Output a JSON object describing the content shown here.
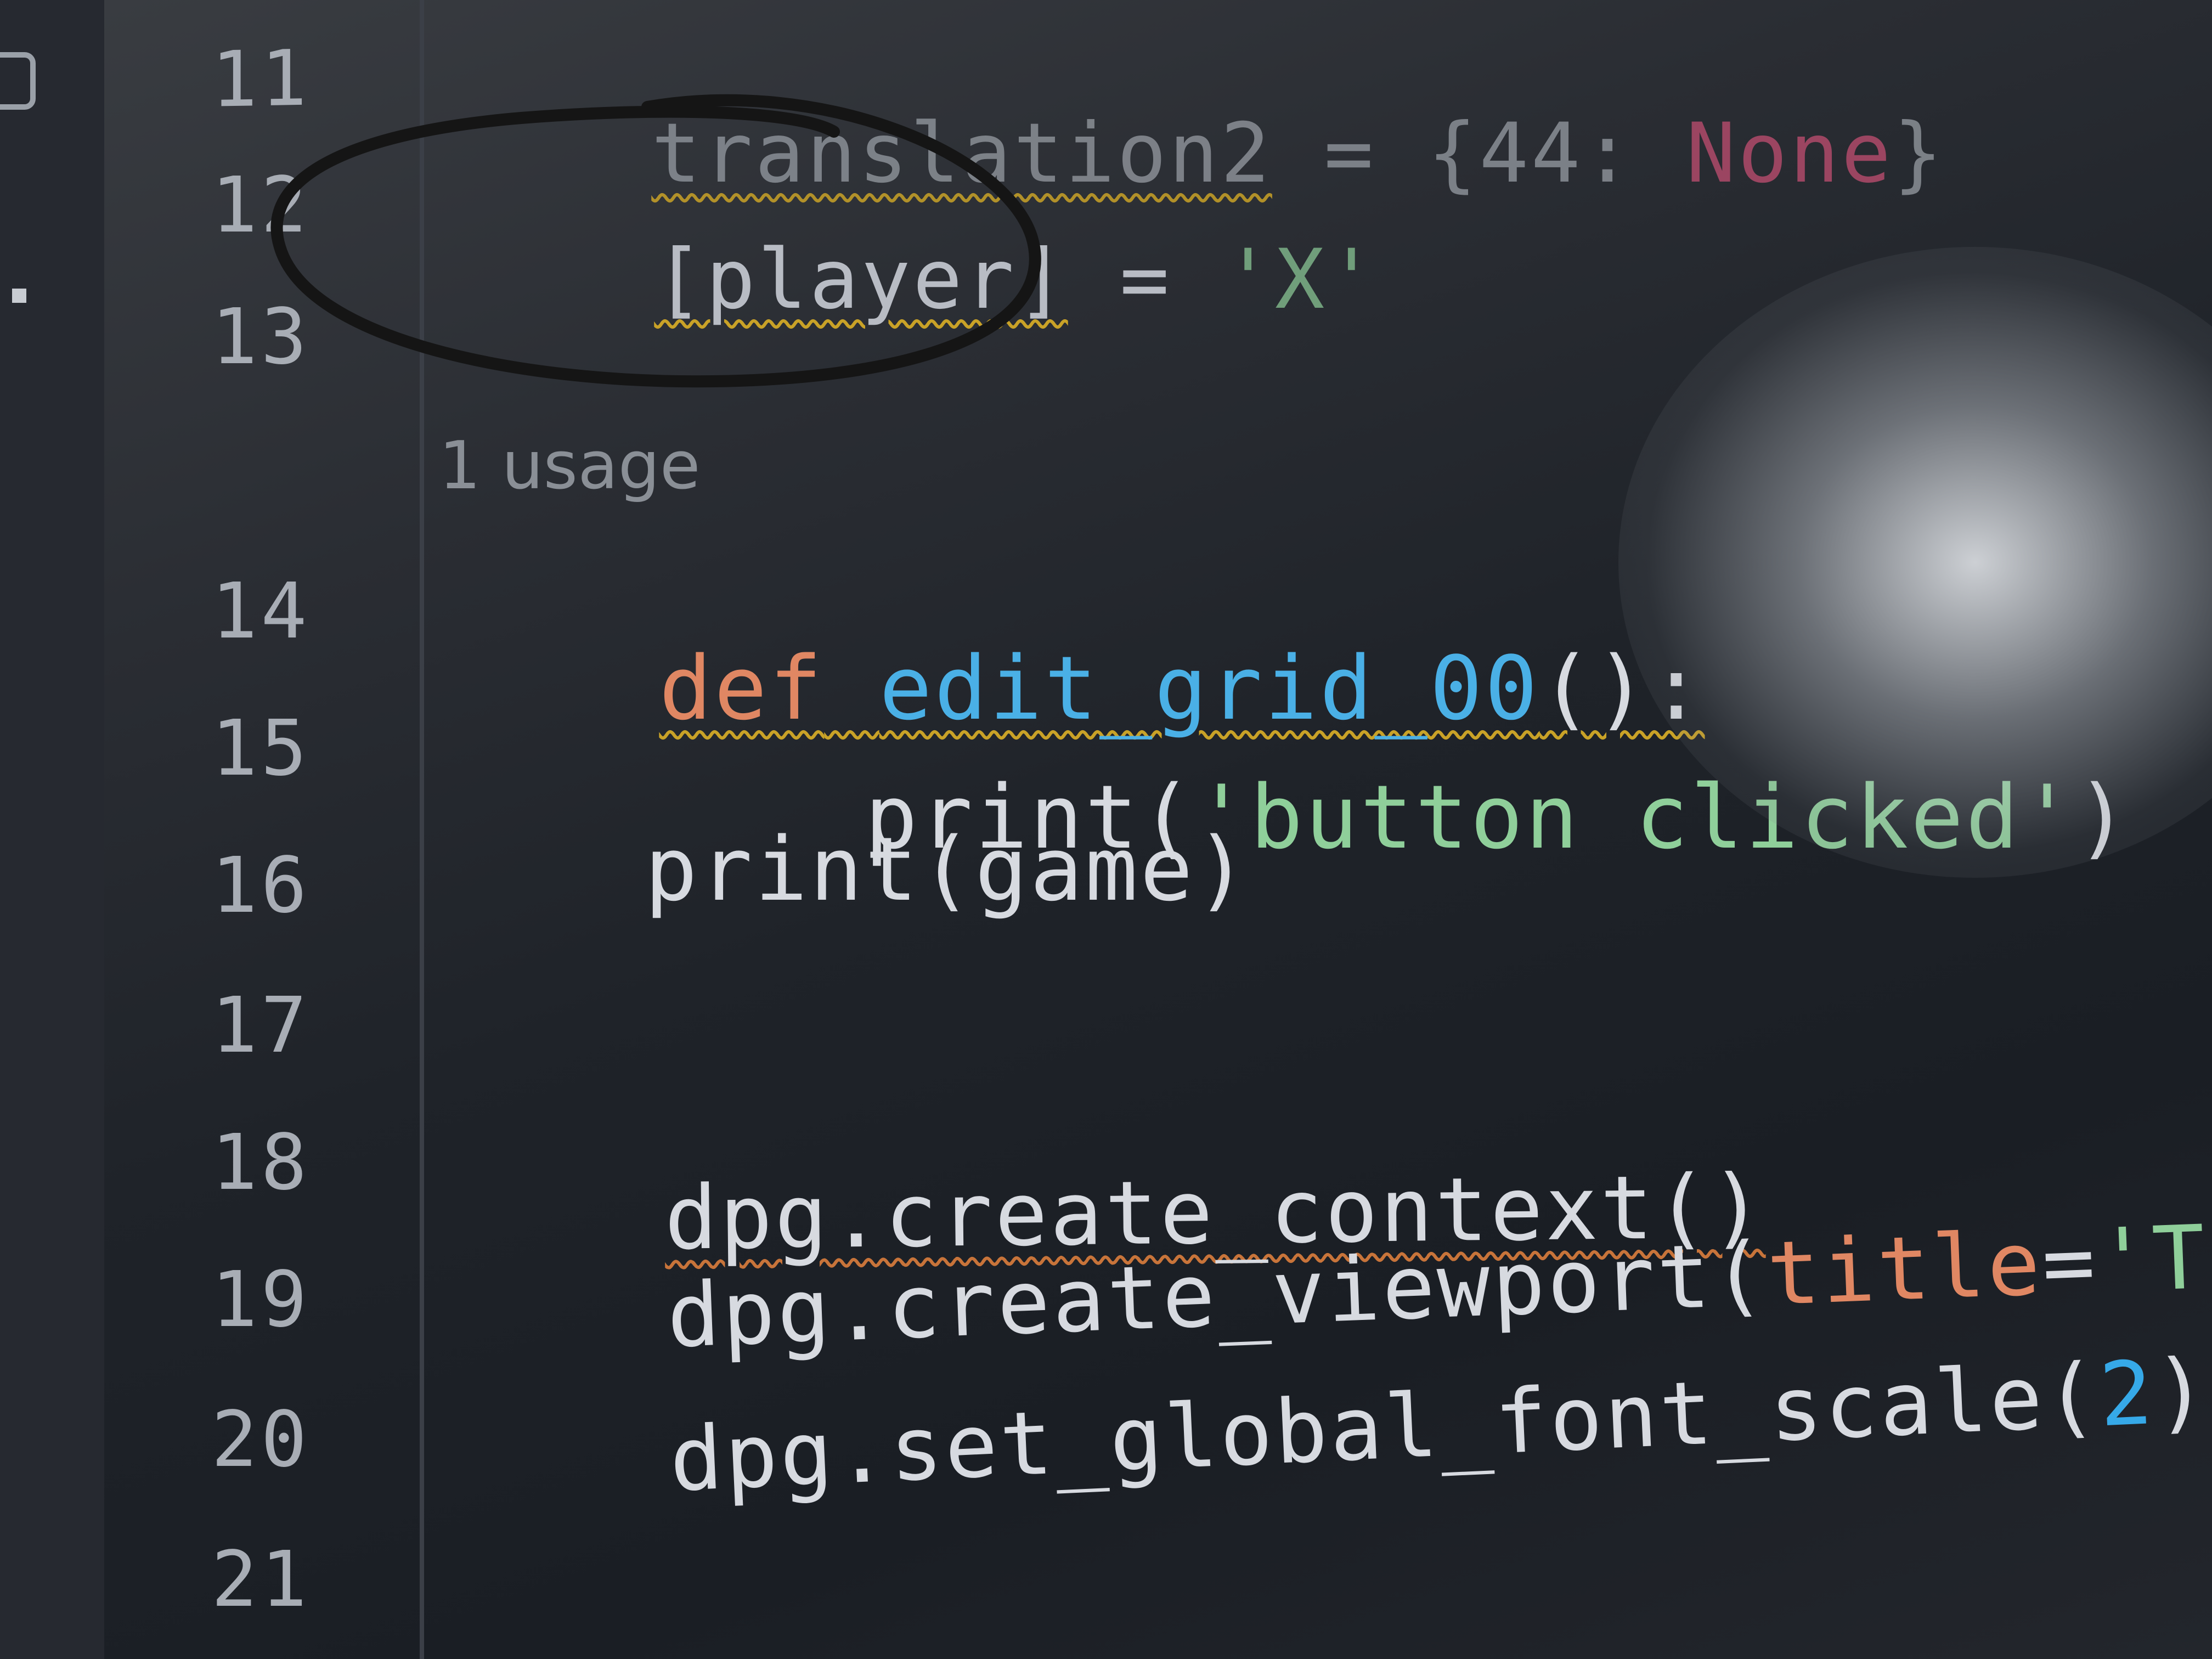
{
  "editor": {
    "gutter": {
      "line_numbers": [
        "11",
        "12",
        "13",
        "14",
        "15",
        "16",
        "17",
        "18",
        "19",
        "20",
        "21"
      ]
    },
    "inlay_hint": "1 usage",
    "lines": {
      "l11": {
        "var": "translation2",
        "eq": " = ",
        "open": "{",
        "key": "44",
        "colon": ": ",
        "val": "None",
        "close": "}"
      },
      "l12": {
        "lhs": "[player]",
        "eq": " = ",
        "rhs": "'X'"
      },
      "l14": {
        "kw": "def",
        "fn": "edit_grid_00",
        "rest": "():"
      },
      "l15": {
        "fn": "print(",
        "str": "'button clicked'",
        "close": ")"
      },
      "l16": {
        "text": "print(game)"
      },
      "l18": {
        "text": "dpg.create_context()"
      },
      "l19": {
        "pre": "dpg.create_viewport(",
        "param": "title",
        "eq": "=",
        "str": "'TicTacToe'",
        "tail": ","
      },
      "l20": {
        "pre": "dpg.set_global_font_scale(",
        "num": "2",
        "close": ")"
      }
    }
  },
  "colors": {
    "keyword": "#e08763",
    "function": "#4ab0e6",
    "string": "#8fcf9a",
    "number": "#36a9e8",
    "none_value": "#b04a6a",
    "background": "#1f2329",
    "annotation": "#1a1a1a"
  }
}
